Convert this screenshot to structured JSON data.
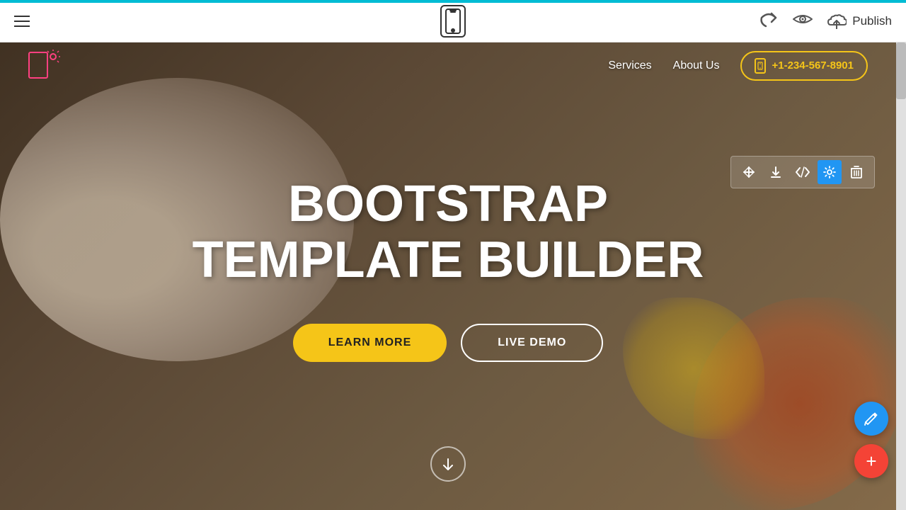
{
  "toolbar": {
    "hamburger_label": "menu",
    "undo_label": "↺",
    "eye_label": "👁",
    "publish_label": "Publish",
    "cloud_icon": "☁"
  },
  "site": {
    "navbar": {
      "nav_links": [
        {
          "label": "Services"
        },
        {
          "label": "About Us"
        }
      ],
      "phone": "+1-234-567-8901"
    },
    "hero": {
      "title_line1": "BOOTSTRAP",
      "title_line2": "TEMPLATE BUILDER",
      "btn_learn_more": "LEARN MORE",
      "btn_live_demo": "LIVE DEMO"
    }
  },
  "section_tools": [
    {
      "icon": "⇅",
      "name": "move"
    },
    {
      "icon": "⬇",
      "name": "download"
    },
    {
      "icon": "</>",
      "name": "code"
    },
    {
      "icon": "⚙",
      "name": "settings",
      "active": true
    },
    {
      "icon": "🗑",
      "name": "delete"
    }
  ],
  "fabs": {
    "pencil": "✏",
    "add": "+"
  }
}
